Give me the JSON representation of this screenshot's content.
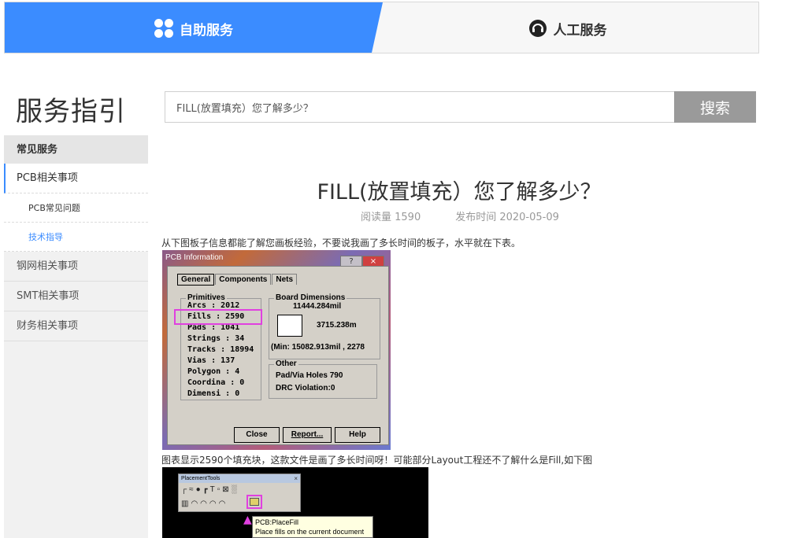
{
  "tabs": {
    "self_service": "自助服务",
    "human_service": "人工服务"
  },
  "page_title": "服务指引",
  "search": {
    "value": "FILL(放置填充）您了解多少？",
    "button": "搜索"
  },
  "sidebar": {
    "header": "常见服务",
    "items": [
      {
        "label": "PCB相关事项"
      },
      {
        "label": "PCB常见问题"
      },
      {
        "label": "技术指导"
      },
      {
        "label": "钢网相关事项"
      },
      {
        "label": "SMT相关事项"
      },
      {
        "label": "财务相关事项"
      }
    ]
  },
  "article": {
    "title": "FILL(放置填充）您了解多少？",
    "read_count": "阅读量 1590",
    "publish_time": "发布时间 2020-05-09",
    "para1": "从下图板子信息都能了解您画板经验，不要说我画了多长时间的板子，水平就在下表。",
    "para2": "图表显示2590个填充块，这款文件是画了多长时间呀！可能部分Layout工程还不了解什么是Fill,如下图"
  },
  "pcb_dialog": {
    "title": "PCB Information",
    "title_buttons": [
      "?",
      "×"
    ],
    "tabs": [
      "General",
      "Components",
      "Nets"
    ],
    "primitives_label": "Primitives",
    "primitives": [
      {
        "name": "Arcs",
        "value": "2012"
      },
      {
        "name": "Fills",
        "value": "2590"
      },
      {
        "name": "Pads",
        "value": "1041"
      },
      {
        "name": "Strings",
        "value": "34"
      },
      {
        "name": "Tracks",
        "value": "18994"
      },
      {
        "name": "Vias",
        "value": "137"
      },
      {
        "name": "Polygon",
        "value": "4"
      },
      {
        "name": "Coordina",
        "value": "0"
      },
      {
        "name": "Dimensi",
        "value": "0"
      }
    ],
    "board_dimensions_label": "Board Dimensions",
    "width": "11444.284mil",
    "height": "3715.238m",
    "min": "(Min: 15082.913mil , 2278",
    "other_label": "Other",
    "pad_via_holes": "Pad/Via Holes 790",
    "drc_violation": "DRC Violation:0",
    "buttons": [
      "Close",
      "Report...",
      "Help"
    ]
  },
  "placement_tools": {
    "title": "PlacementTools",
    "close": "×",
    "tooltip_line1": "PCB:PlaceFill",
    "tooltip_line2": "Place fills on the current document"
  }
}
